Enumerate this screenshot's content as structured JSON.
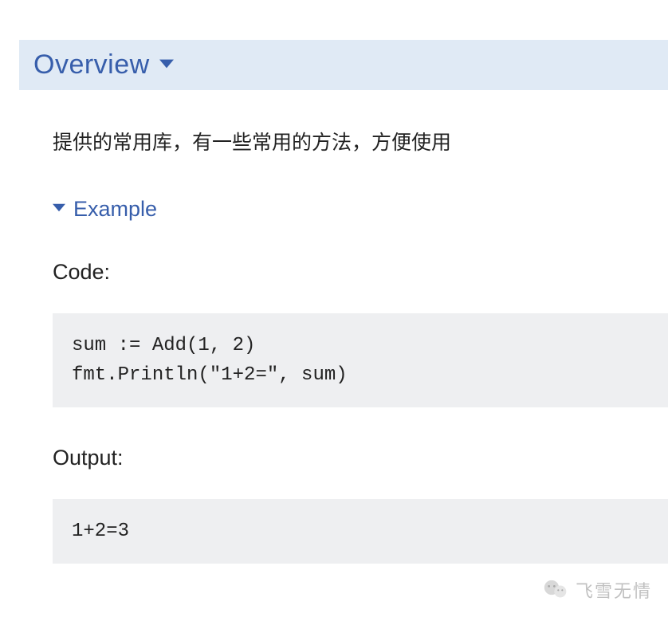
{
  "section": {
    "title": "Overview"
  },
  "description": "提供的常用库，有一些常用的方法，方便使用",
  "example": {
    "label": "Example",
    "code_label": "Code:",
    "code": "sum := Add(1, 2)\nfmt.Println(\"1+2=\", sum)",
    "output_label": "Output:",
    "output": "1+2=3"
  },
  "watermark": {
    "text": "飞雪无情"
  }
}
